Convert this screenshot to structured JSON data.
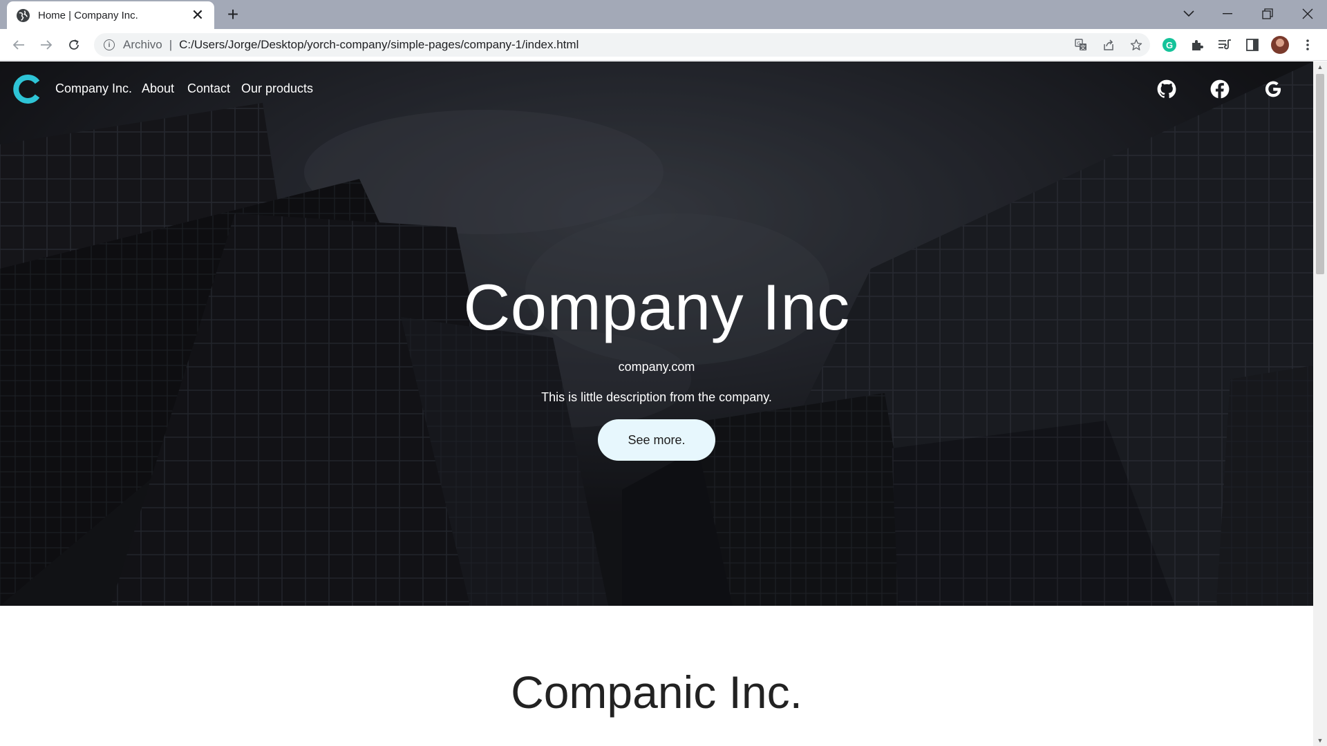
{
  "browser": {
    "tab_title": "Home | Company Inc.",
    "new_tab_symbol": "+",
    "close_symbol": "✕",
    "address_scheme": "Archivo",
    "address_separator": "|",
    "url": "C:/Users/Jorge/Desktop/yorch-company/simple-pages/company-1/index.html",
    "icons": [
      "globe-icon",
      "back-icon",
      "forward-icon",
      "reload-icon",
      "info-icon",
      "translate-icon",
      "share-icon",
      "star-icon",
      "grammarly-icon",
      "extensions-icon",
      "reading-list-icon",
      "side-panel-icon",
      "profile-avatar",
      "menu-icon",
      "tab-search-icon",
      "minimize-icon",
      "restore-icon",
      "close-window-icon"
    ]
  },
  "site": {
    "brand": "Company Inc.",
    "nav": {
      "about": "About",
      "contact": "Contact",
      "products": "Our products"
    },
    "social_icons": [
      "github-icon",
      "facebook-icon",
      "google-icon"
    ],
    "hero": {
      "title": "Company Inc",
      "domain": "company.com",
      "description": "This is little description from the company.",
      "button": "See more."
    },
    "section_title": "Companic Inc.",
    "accent_color": "#2ec4d6"
  }
}
